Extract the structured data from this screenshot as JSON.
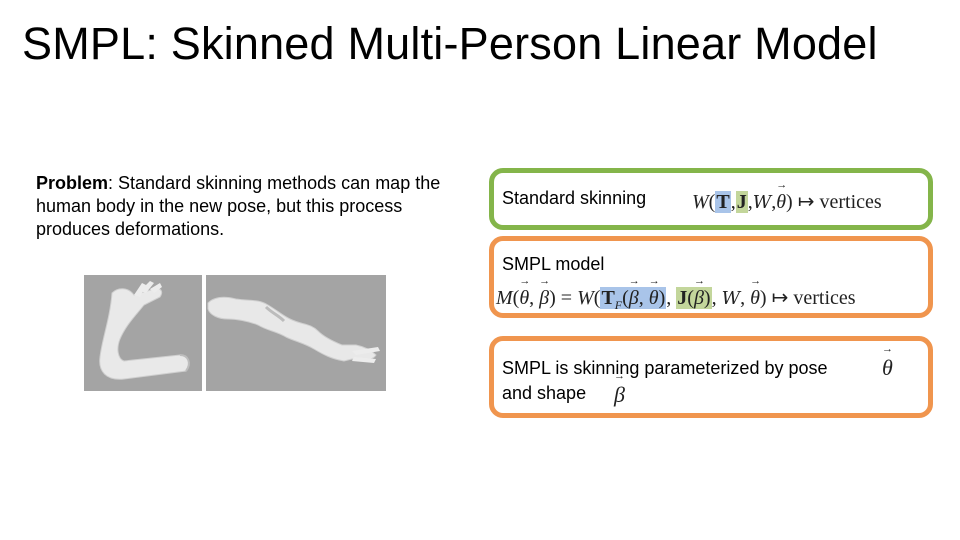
{
  "slide": {
    "title": "SMPL: Skinned Multi-Person Linear Model"
  },
  "problem": {
    "label": "Problem",
    "text": ": Standard skinning methods can map the human body in the new pose, but this process produces deformations."
  },
  "boxes": {
    "standard": {
      "label": "Standard skinning",
      "vertices": "vertices"
    },
    "smpl": {
      "label": "SMPL model",
      "vertices": "vertices"
    },
    "param": {
      "line1": "SMPL is skinning parameterized by pose",
      "line2": "and shape"
    }
  },
  "colors": {
    "green_border": "#84b54a",
    "orange_border": "#f0954e",
    "blue_highlight": "#a9c4e9",
    "green_highlight": "#c3d69b"
  }
}
